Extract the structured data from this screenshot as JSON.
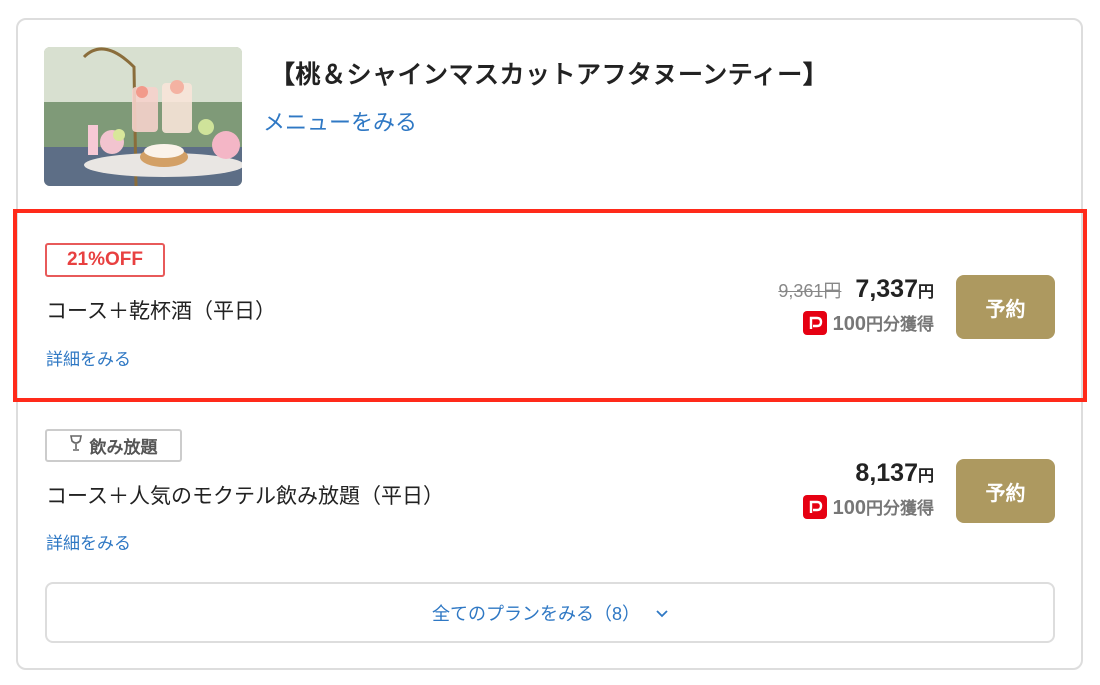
{
  "plan": {
    "title": "【桃＆シャインマスカットアフタヌーンティー】",
    "menu_link": "メニューをみる",
    "image_alt": "afternoon tea stand with peach and shine muscat sweets"
  },
  "courses": [
    {
      "badge": "21%OFF",
      "name": "コース＋乾杯酒（平日）",
      "detail_link": "詳細をみる",
      "old_price": "9,361円",
      "price": "7,337",
      "yen": "円",
      "points_amount": "100",
      "points_suffix": "円分獲得",
      "reserve_label": "予約"
    },
    {
      "badge": "飲み放題",
      "badge_icon": "wine-glass-icon",
      "name": "コース＋人気のモクテル飲み放題（平日）",
      "detail_link": "詳細をみる",
      "price": "8,137",
      "yen": "円",
      "points_amount": "100",
      "points_suffix": "円分獲得",
      "reserve_label": "予約"
    }
  ],
  "all_plans_label": "全てのプランをみる（8）",
  "colors": {
    "accent_link": "#2f78c4",
    "reserve_button": "#ad9960",
    "discount_badge": "#e84040",
    "highlight_border": "#ff2a1a",
    "paypay": "#e60012"
  }
}
